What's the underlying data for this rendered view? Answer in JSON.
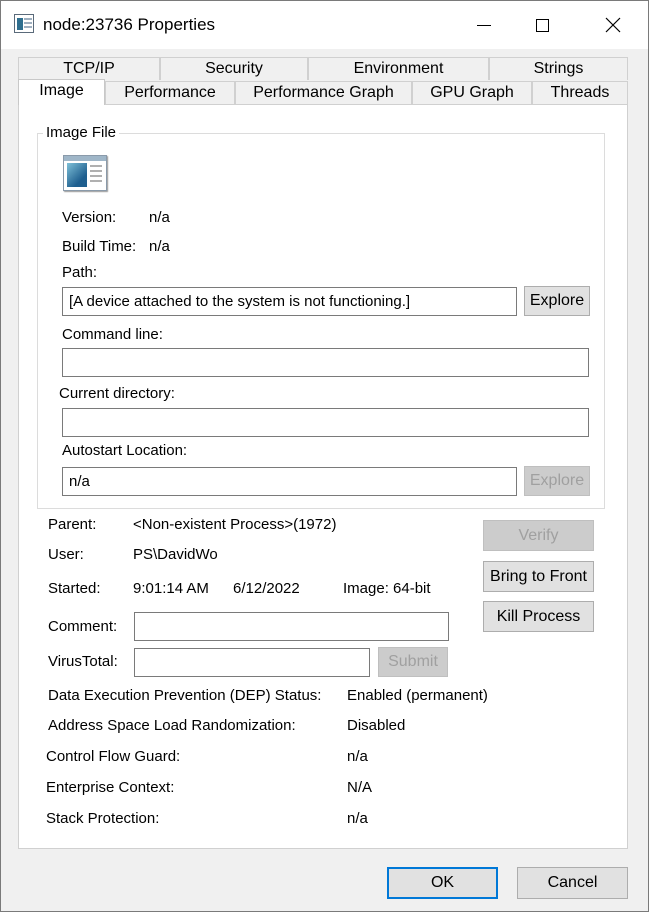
{
  "window": {
    "title": "node:23736 Properties",
    "controls": {
      "minimize": "minimize",
      "maximize": "maximize",
      "close": "✕"
    }
  },
  "tabs_row1": [
    "TCP/IP",
    "Security",
    "Environment",
    "Strings"
  ],
  "tabs_row2": [
    "Image",
    "Performance",
    "Performance Graph",
    "GPU Graph",
    "Threads"
  ],
  "active_tab": "Image",
  "image_file": {
    "group_label": "Image File",
    "version_label": "Version:",
    "version_value": "n/a",
    "build_time_label": "Build Time:",
    "build_time_value": "n/a",
    "path_label": "Path:",
    "path_value": "[A device attached to the system is not functioning.]",
    "explore_label": "Explore",
    "command_line_label": "Command line:",
    "command_line_value": "",
    "current_directory_label": "Current directory:",
    "current_directory_value": "",
    "autostart_label": "Autostart Location:",
    "autostart_value": "n/a",
    "autostart_explore_label": "Explore"
  },
  "process": {
    "parent_label": "Parent:",
    "parent_value": "<Non-existent Process>(1972)",
    "user_label": "User:",
    "user_value": "PS\\DavidWo",
    "started_label": "Started:",
    "started_time": "9:01:14 AM",
    "started_date": "6/12/2022",
    "image_bits": "Image: 64-bit",
    "comment_label": "Comment:",
    "comment_value": "",
    "virustotal_label": "VirusTotal:",
    "virustotal_value": "",
    "submit_label": "Submit",
    "verify_label": "Verify",
    "bring_to_front_label": "Bring to Front",
    "kill_process_label": "Kill Process"
  },
  "security": {
    "dep_label": "Data Execution Prevention (DEP) Status:",
    "dep_value": "Enabled (permanent)",
    "aslr_label": "Address Space Load Randomization:",
    "aslr_value": "Disabled",
    "cfg_label": "Control Flow Guard:",
    "cfg_value": "n/a",
    "enterprise_label": "Enterprise Context:",
    "enterprise_value": "N/A",
    "stack_label": "Stack Protection:",
    "stack_value": "n/a"
  },
  "footer": {
    "ok_label": "OK",
    "cancel_label": "Cancel"
  }
}
